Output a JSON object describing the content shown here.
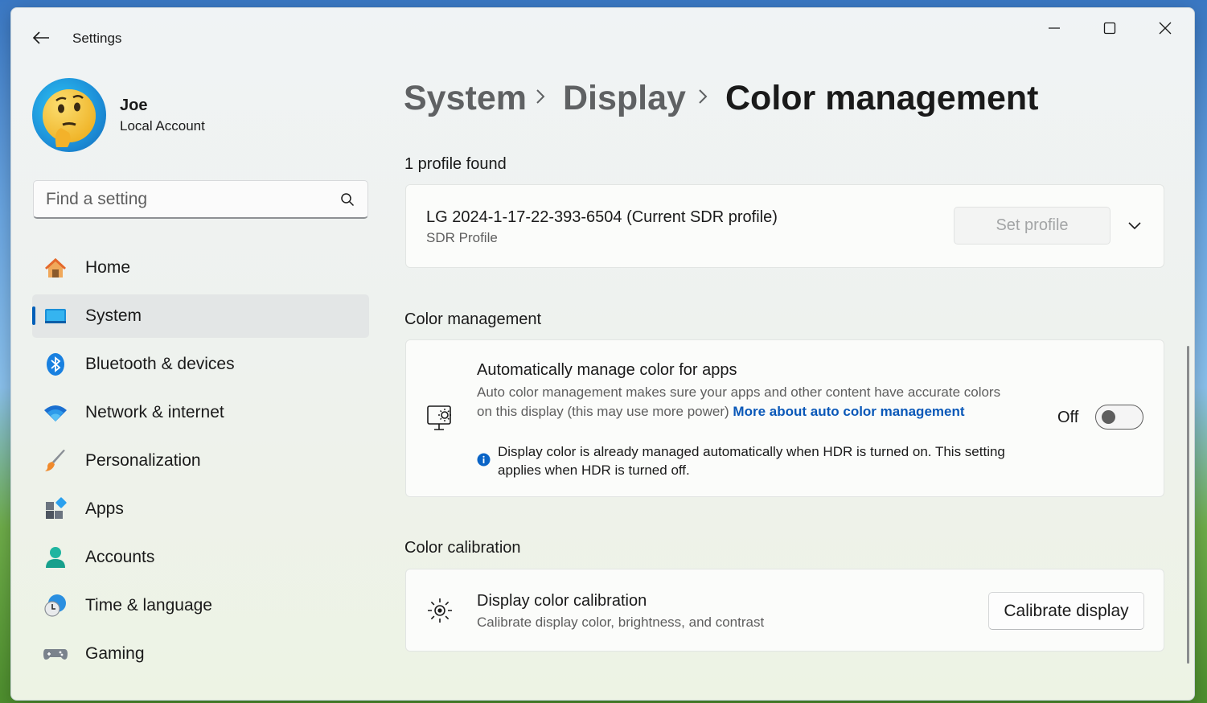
{
  "window": {
    "title": "Settings"
  },
  "user": {
    "name": "Joe",
    "account_type": "Local Account"
  },
  "search": {
    "placeholder": "Find a setting"
  },
  "nav": [
    {
      "label": "Home",
      "icon": "home-icon"
    },
    {
      "label": "System",
      "icon": "system-monitor-icon",
      "active": true
    },
    {
      "label": "Bluetooth & devices",
      "icon": "bluetooth-icon"
    },
    {
      "label": "Network & internet",
      "icon": "wifi-icon"
    },
    {
      "label": "Personalization",
      "icon": "paintbrush-icon"
    },
    {
      "label": "Apps",
      "icon": "apps-icon"
    },
    {
      "label": "Accounts",
      "icon": "accounts-icon"
    },
    {
      "label": "Time & language",
      "icon": "time-language-icon"
    },
    {
      "label": "Gaming",
      "icon": "gamepad-icon"
    }
  ],
  "breadcrumb": {
    "level1": "System",
    "level2": "Display",
    "current": "Color management"
  },
  "profiles": {
    "count_label": "1 profile found",
    "name": "LG 2024-1-17-22-393-6504 (Current SDR profile)",
    "type": "SDR Profile",
    "button": "Set profile"
  },
  "color_management": {
    "heading": "Color management",
    "title": "Automatically manage color for apps",
    "desc": "Auto color management makes sure your apps and other content have accurate colors on this display (this may use more power)",
    "link": "More about auto color management",
    "info": "Display color is already managed automatically when HDR is turned on. This setting applies when HDR is turned off.",
    "toggle_state": "Off"
  },
  "calibration": {
    "heading": "Color calibration",
    "title": "Display color calibration",
    "desc": "Calibrate display color, brightness, and contrast",
    "button": "Calibrate display"
  },
  "colors": {
    "accent": "#005fb8",
    "link": "#0a58b8"
  }
}
